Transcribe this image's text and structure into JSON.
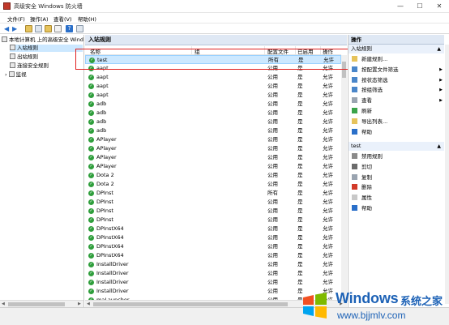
{
  "window": {
    "title": "高级安全 Windows 防火墙",
    "minimize_glyph": "—",
    "maximize_glyph": "☐",
    "close_glyph": "✕"
  },
  "menu": [
    "文件(F)",
    "操作(A)",
    "查看(V)",
    "帮助(H)"
  ],
  "tree": {
    "root": "本地计算机 上的高级安全 Windo",
    "items": [
      "入站规则",
      "出站规则",
      "连接安全规则",
      "监视"
    ],
    "expander": "›"
  },
  "center": {
    "header": "入站规则",
    "columns": [
      "名称",
      "组",
      "配置文件",
      "已启用",
      "操作"
    ],
    "rows": [
      {
        "name": "test",
        "group": "",
        "profile": "所有",
        "enabled": "是",
        "action": "允许"
      },
      {
        "name": "aapt",
        "group": "",
        "profile": "公用",
        "enabled": "是",
        "action": "允许"
      },
      {
        "name": "aapt",
        "group": "",
        "profile": "公用",
        "enabled": "是",
        "action": "允许"
      },
      {
        "name": "aapt",
        "group": "",
        "profile": "公用",
        "enabled": "是",
        "action": "允许"
      },
      {
        "name": "aapt",
        "group": "",
        "profile": "公用",
        "enabled": "是",
        "action": "允许"
      },
      {
        "name": "adb",
        "group": "",
        "profile": "公用",
        "enabled": "是",
        "action": "允许"
      },
      {
        "name": "adb",
        "group": "",
        "profile": "公用",
        "enabled": "是",
        "action": "允许"
      },
      {
        "name": "adb",
        "group": "",
        "profile": "公用",
        "enabled": "是",
        "action": "允许"
      },
      {
        "name": "adb",
        "group": "",
        "profile": "公用",
        "enabled": "是",
        "action": "允许"
      },
      {
        "name": "APlayer",
        "group": "",
        "profile": "公用",
        "enabled": "是",
        "action": "允许"
      },
      {
        "name": "APlayer",
        "group": "",
        "profile": "公用",
        "enabled": "是",
        "action": "允许"
      },
      {
        "name": "APlayer",
        "group": "",
        "profile": "公用",
        "enabled": "是",
        "action": "允许"
      },
      {
        "name": "APlayer",
        "group": "",
        "profile": "公用",
        "enabled": "是",
        "action": "允许"
      },
      {
        "name": "Dota 2",
        "group": "",
        "profile": "公用",
        "enabled": "是",
        "action": "允许"
      },
      {
        "name": "Dota 2",
        "group": "",
        "profile": "公用",
        "enabled": "是",
        "action": "允许"
      },
      {
        "name": "DPInst",
        "group": "",
        "profile": "所有",
        "enabled": "是",
        "action": "允许"
      },
      {
        "name": "DPInst",
        "group": "",
        "profile": "公用",
        "enabled": "是",
        "action": "允许"
      },
      {
        "name": "DPInst",
        "group": "",
        "profile": "公用",
        "enabled": "是",
        "action": "允许"
      },
      {
        "name": "DPInst",
        "group": "",
        "profile": "公用",
        "enabled": "是",
        "action": "允许"
      },
      {
        "name": "DPInstX64",
        "group": "",
        "profile": "公用",
        "enabled": "是",
        "action": "允许"
      },
      {
        "name": "DPInstX64",
        "group": "",
        "profile": "公用",
        "enabled": "是",
        "action": "允许"
      },
      {
        "name": "DPInstX64",
        "group": "",
        "profile": "公用",
        "enabled": "是",
        "action": "允许"
      },
      {
        "name": "DPInstX64",
        "group": "",
        "profile": "公用",
        "enabled": "是",
        "action": "允许"
      },
      {
        "name": "InstallDriver",
        "group": "",
        "profile": "公用",
        "enabled": "是",
        "action": "允许"
      },
      {
        "name": "InstallDriver",
        "group": "",
        "profile": "公用",
        "enabled": "是",
        "action": "允许"
      },
      {
        "name": "InstallDriver",
        "group": "",
        "profile": "公用",
        "enabled": "是",
        "action": "允许"
      },
      {
        "name": "InstallDriver",
        "group": "",
        "profile": "公用",
        "enabled": "是",
        "action": "允许"
      },
      {
        "name": "maLauncher",
        "group": "",
        "profile": "公用",
        "enabled": "是",
        "action": "允许"
      }
    ]
  },
  "actions": {
    "section1_title": "操作",
    "section1_sub": "入站规则",
    "section1_items": [
      {
        "label": "新建规则...",
        "icon": "new-rule-icon",
        "arrow": ""
      },
      {
        "label": "按配置文件筛选",
        "icon": "filter-icon",
        "arrow": "▶"
      },
      {
        "label": "按状态筛选",
        "icon": "filter-icon",
        "arrow": "▶"
      },
      {
        "label": "按组筛选",
        "icon": "filter-icon",
        "arrow": "▶"
      },
      {
        "label": "查看",
        "icon": "view-icon",
        "arrow": "▶"
      },
      {
        "label": "刷新",
        "icon": "refresh-icon",
        "arrow": ""
      },
      {
        "label": "导出列表...",
        "icon": "export-icon",
        "arrow": ""
      },
      {
        "label": "帮助",
        "icon": "help-icon",
        "arrow": ""
      }
    ],
    "section2_sub": "test",
    "section2_items": [
      {
        "label": "禁用规则",
        "icon": "disable-icon"
      },
      {
        "label": "剪切",
        "icon": "cut-icon"
      },
      {
        "label": "复制",
        "icon": "copy-icon"
      },
      {
        "label": "删除",
        "icon": "delete-icon"
      },
      {
        "label": "属性",
        "icon": "properties-icon"
      },
      {
        "label": "帮助",
        "icon": "help-icon"
      }
    ]
  },
  "watermark": {
    "brand": "Windows",
    "cn": "系统之家",
    "url": "www.bjjmlv.com"
  },
  "colors": {
    "selection": "#cce8ff",
    "header_bg": "#dfe8f4",
    "allow_green": "#2f9e3c",
    "highlight_red": "#e02020",
    "brand_blue": "#1d62b6"
  }
}
